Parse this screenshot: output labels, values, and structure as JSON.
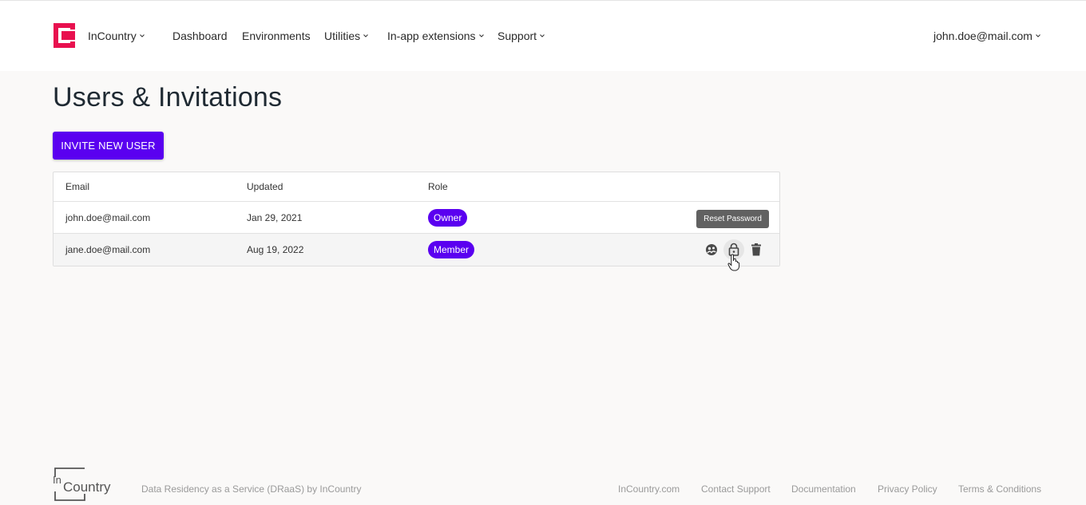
{
  "header": {
    "brand": "InCountry",
    "nav": {
      "dashboard": "Dashboard",
      "environments": "Environments",
      "utilities": "Utilities",
      "inapp": "In-app extensions",
      "support": "Support"
    },
    "user": "john.doe@mail.com"
  },
  "page": {
    "title": "Users & Invitations",
    "invite_button": "INVITE NEW USER"
  },
  "table": {
    "columns": {
      "email": "Email",
      "updated": "Updated",
      "role": "Role"
    },
    "rows": [
      {
        "email": "john.doe@mail.com",
        "updated": "Jan 29, 2021",
        "role": "Owner"
      },
      {
        "email": "jane.doe@mail.com",
        "updated": "Aug 19, 2022",
        "role": "Member"
      }
    ],
    "tooltip": "Reset Password"
  },
  "footer": {
    "logo_text_in": "In",
    "logo_text_country": "Country",
    "tagline": "Data Residency as a Service (DRaaS) by InCountry",
    "links": {
      "site": "InCountry.com",
      "contact": "Contact Support",
      "docs": "Documentation",
      "privacy": "Privacy Policy",
      "terms": "Terms & Conditions"
    }
  },
  "colors": {
    "accent": "#5a00f0",
    "logo": "#e8104f",
    "background": "#faf9f8",
    "tooltip": "#616161"
  }
}
